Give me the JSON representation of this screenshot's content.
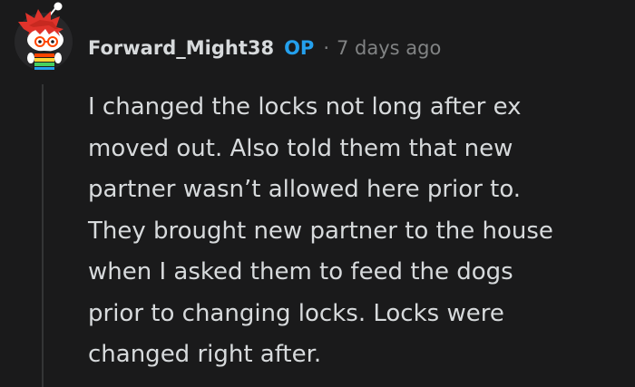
{
  "comment": {
    "author": "Forward_Might38",
    "op_badge": "OP",
    "separator": "·",
    "timestamp": "7 days ago",
    "body_lines": [
      "I changed the locks not long after ex",
      "moved out. Also told them that new",
      "partner wasn’t allowed here prior to.",
      "They brought new partner to the house",
      "when I asked them to feed the dogs",
      "prior to changing locks. Locks were",
      "changed right after."
    ]
  },
  "colors": {
    "background": "#1a1a1b",
    "text": "#d7dadc",
    "muted": "#818384",
    "op_badge": "#24a0ed",
    "thread_line": "#343536"
  },
  "avatar_icon": "snoo-avatar-icon"
}
